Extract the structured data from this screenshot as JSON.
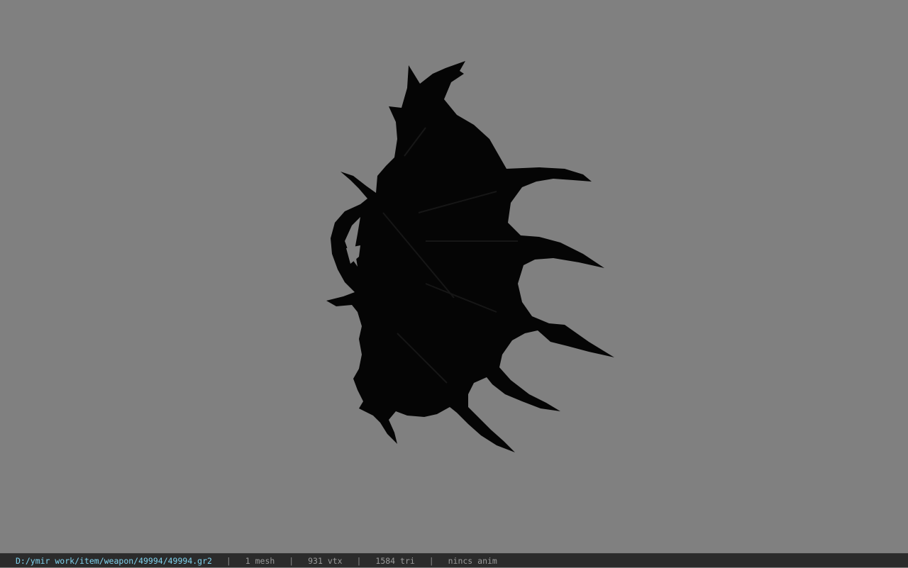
{
  "viewport": {
    "background_color": "#808080",
    "model_color": "#050505",
    "model_icon": "spiked-shield-model"
  },
  "status": {
    "file_path": "D:/ymir work/item/weapon/49994/49994.gr2",
    "separator": "|",
    "mesh": "1 mesh",
    "vertices": "931 vtx",
    "triangles": "1584 tri",
    "animation": "nincs anim",
    "path_color": "#7fd3ef"
  }
}
